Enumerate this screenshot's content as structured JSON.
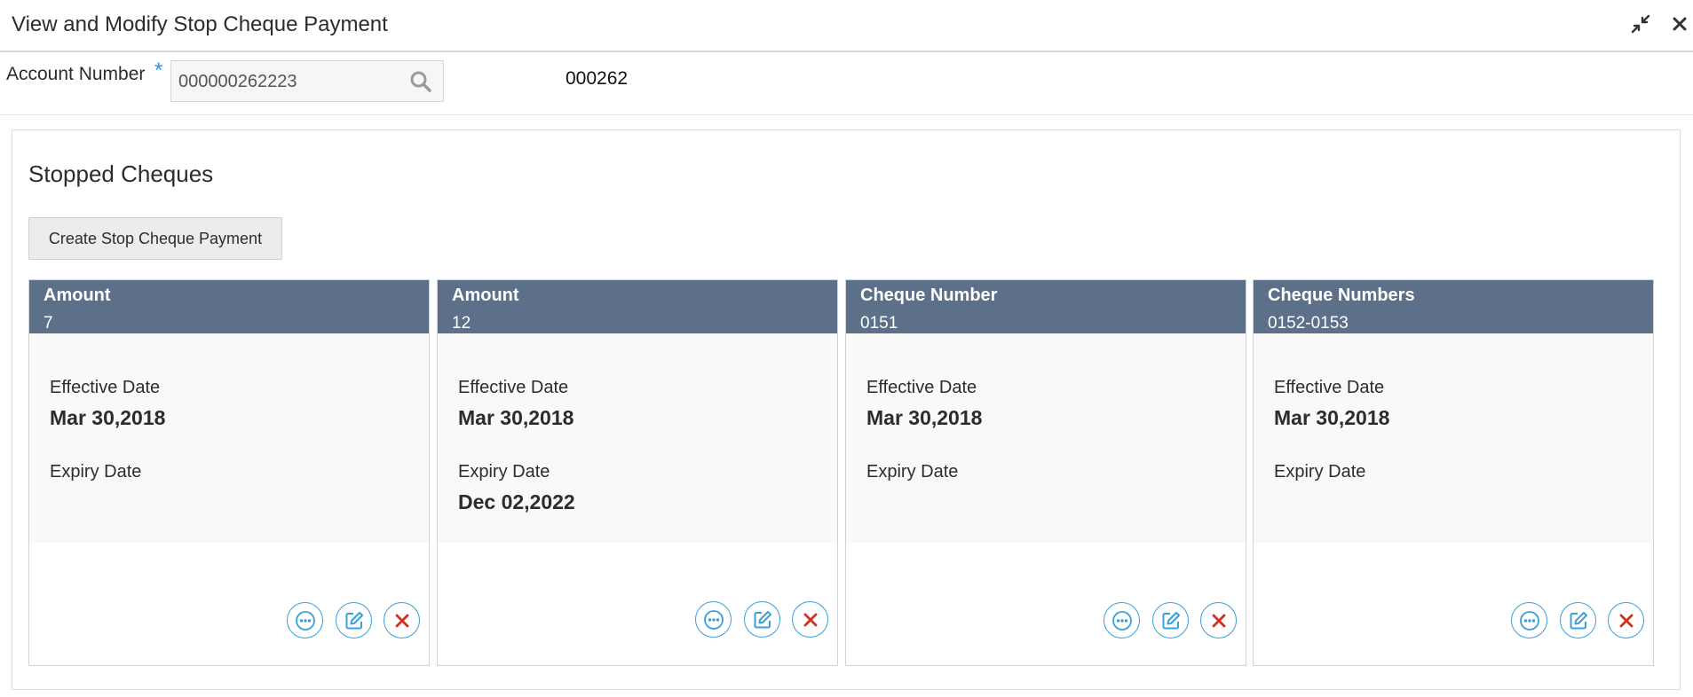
{
  "window": {
    "title": "View and Modify Stop Cheque Payment",
    "minimize_icon": "collapse-arrows-icon",
    "close_icon": "close-icon"
  },
  "account": {
    "label": "Account Number",
    "required_marker": "*",
    "value": "000000262223",
    "search_icon": "search-icon",
    "name": "000262"
  },
  "section": {
    "title": "Stopped Cheques",
    "create_button": "Create Stop Cheque Payment"
  },
  "cards": [
    {
      "head_label": "Amount",
      "head_value": "7",
      "effective_label": "Effective Date",
      "effective_value": "Mar 30,2018",
      "expiry_label": "Expiry Date",
      "expiry_value": ""
    },
    {
      "head_label": "Amount",
      "head_value": "12",
      "effective_label": "Effective Date",
      "effective_value": "Mar 30,2018",
      "expiry_label": "Expiry Date",
      "expiry_value": "Dec 02,2022"
    },
    {
      "head_label": "Cheque Number",
      "head_value": "0151",
      "effective_label": "Effective Date",
      "effective_value": "Mar 30,2018",
      "expiry_label": "Expiry Date",
      "expiry_value": ""
    },
    {
      "head_label": "Cheque Numbers",
      "head_value": "0152-0153",
      "effective_label": "Effective Date",
      "effective_value": "Mar 30,2018",
      "expiry_label": "Expiry Date",
      "expiry_value": ""
    }
  ],
  "card_actions": {
    "view_icon": "more-options-icon",
    "edit_icon": "edit-icon",
    "delete_icon": "delete-x-icon"
  },
  "colors": {
    "card_header": "#5d7089",
    "action_border": "#3aa0d8",
    "delete_x": "#d1301f",
    "required": "#3a8fd6"
  }
}
